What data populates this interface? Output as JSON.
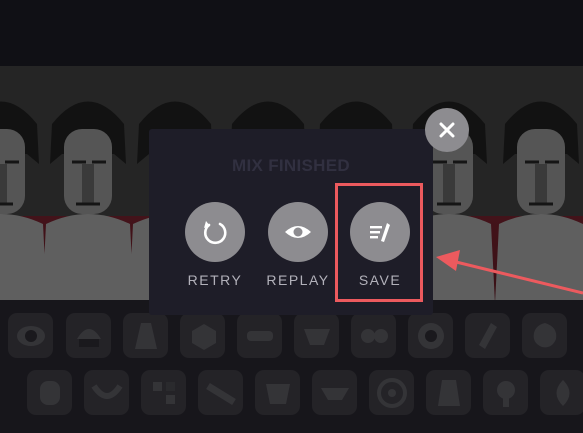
{
  "modal": {
    "title": "MIX FINISHED",
    "actions": [
      {
        "label": "RETRY",
        "icon": "retry-icon"
      },
      {
        "label": "REPLAY",
        "icon": "eye-icon"
      },
      {
        "label": "SAVE",
        "icon": "save-icon"
      }
    ],
    "close_icon": "close-icon"
  },
  "annotation": {
    "color": "#ec5a5e",
    "target": "SAVE"
  },
  "colors": {
    "overlay": "#1e1d28",
    "button": "#8d8c90",
    "stage_floor": "#6d1f2a",
    "tray": "#26252c"
  }
}
